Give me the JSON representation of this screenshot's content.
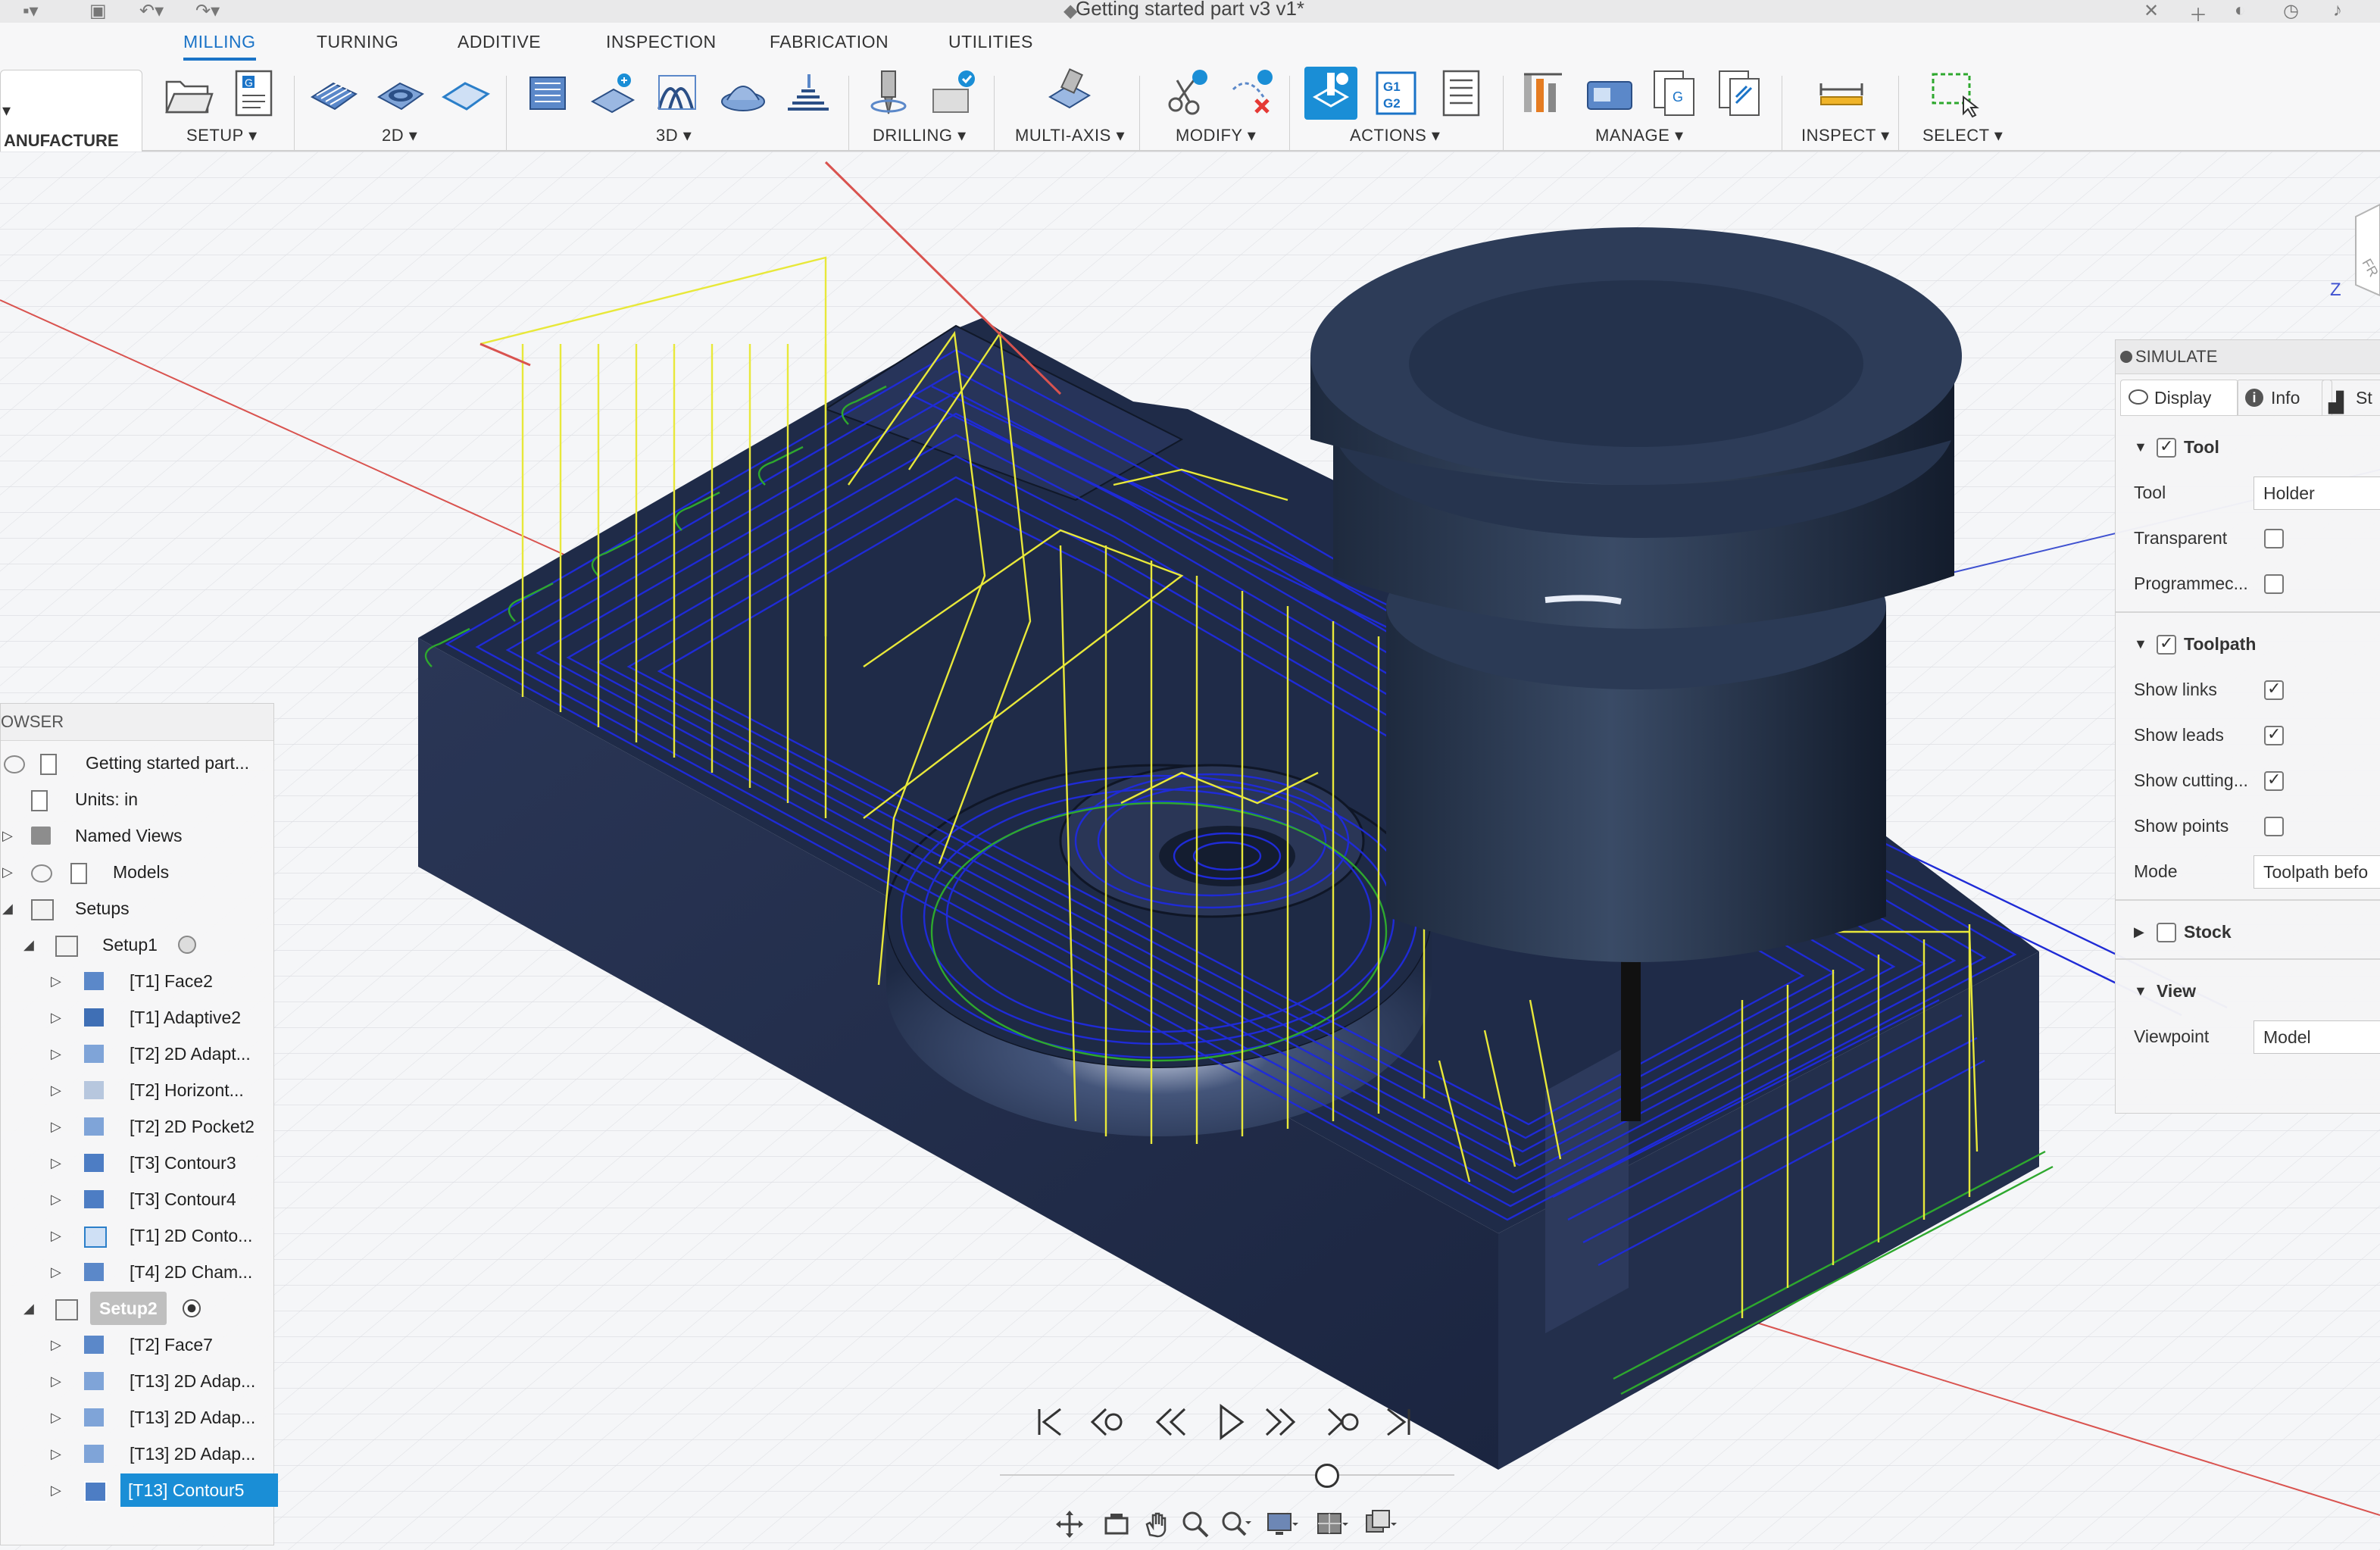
{
  "window": {
    "title": "Getting started part v3 v1*"
  },
  "workspace": {
    "label": "ANUFACTURE"
  },
  "tabs": [
    {
      "label": "MILLING",
      "active": true
    },
    {
      "label": "TURNING",
      "active": false
    },
    {
      "label": "ADDITIVE",
      "active": false
    },
    {
      "label": "INSPECTION",
      "active": false
    },
    {
      "label": "FABRICATION",
      "active": false
    },
    {
      "label": "UTILITIES",
      "active": false
    }
  ],
  "groups": {
    "setup": "SETUP",
    "2d": "2D",
    "3d": "3D",
    "drilling": "DRILLING",
    "multiaxis": "MULTI-AXIS",
    "modify": "MODIFY",
    "actions": "ACTIONS",
    "manage": "MANAGE",
    "inspect": "INSPECT",
    "select": "SELECT"
  },
  "ribbon_glyphs": {
    "nc_program": "G",
    "post_g1": "G1",
    "post_g2": "G2",
    "manage_g": "G"
  },
  "browser": {
    "header": "OWSER",
    "root": "Getting started part...",
    "units": "Units: in",
    "named_views": "Named Views",
    "models": "Models",
    "setups": "Setups",
    "setup1": "Setup1",
    "setup1_ops": [
      "[T1] Face2",
      "[T1] Adaptive2",
      "[T2] 2D Adapt...",
      "[T2] Horizont...",
      "[T2] 2D Pocket2",
      "[T3] Contour3",
      "[T3] Contour4",
      "[T1] 2D Conto...",
      "[T4] 2D Cham..."
    ],
    "setup2": "Setup2",
    "setup2_ops": [
      "[T2] Face7",
      "[T13] 2D Adap...",
      "[T13] 2D Adap...",
      "[T13] 2D Adap...",
      "[T13] Contour5"
    ],
    "selected": "[T13] Contour5"
  },
  "simulate": {
    "header": "SIMULATE",
    "tabs": [
      "Display",
      "Info",
      "St"
    ],
    "tool_section": "Tool",
    "tool_label": "Tool",
    "tool_value": "Holder",
    "transparent": "Transparent",
    "programmed": "Programmec...",
    "toolpath_section": "Toolpath",
    "show_links": "Show links",
    "show_leads": "Show leads",
    "show_cutting": "Show cutting...",
    "show_points": "Show points",
    "mode_label": "Mode",
    "mode_value": "Toolpath befo",
    "stock_section": "Stock",
    "view_section": "View",
    "viewpoint_label": "Viewpoint",
    "viewpoint_value": "Model",
    "checks": {
      "tool": true,
      "transparent": false,
      "programmed": false,
      "toolpath": true,
      "show_links": true,
      "show_leads": true,
      "show_cutting": true,
      "show_points": false,
      "stock": false
    }
  },
  "viewcube": {
    "axis_label": "Z",
    "face_label": "FR"
  },
  "playback": {
    "position": 0.72
  },
  "colors": {
    "accent": "#1a8ed6",
    "part": "#1e2a45",
    "toolpath_blue": "#1f2bd6",
    "toolpath_yellow": "#e8e83a",
    "toolpath_green": "#2ea82e",
    "axis_red": "#d9534f"
  }
}
